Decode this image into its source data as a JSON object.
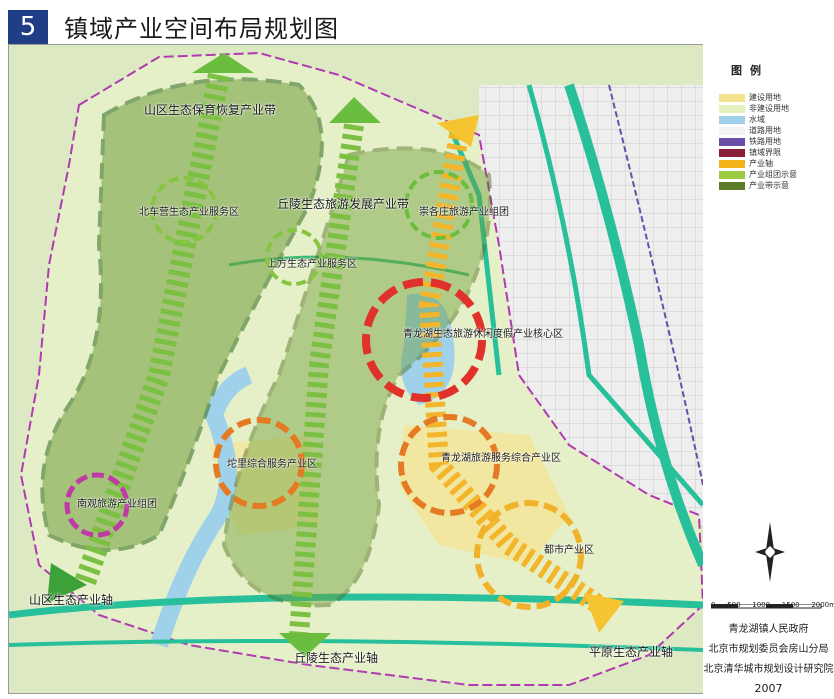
{
  "header": {
    "number": "5",
    "title": "镇域产业空间布局规划图"
  },
  "legend": {
    "title": "图例",
    "items": [
      {
        "label": "建设用地",
        "color": "#f6e38e"
      },
      {
        "label": "非建设用地",
        "color": "#e4f2bf"
      },
      {
        "label": "水域",
        "color": "#9fd2ea"
      },
      {
        "label": "道路用地",
        "color": "#f3f3f3"
      },
      {
        "label": "铁路用地",
        "color": "#6a4ea8"
      },
      {
        "label": "镇域界限",
        "color": "#8b1f3a"
      },
      {
        "label": "产业轴",
        "color": "#f2b31b"
      },
      {
        "label": "产业组团示意",
        "color": "#9ccc44"
      },
      {
        "label": "产业带示意",
        "color": "#5b7d2b"
      }
    ]
  },
  "map_labels": {
    "mountain_belt": "山区生态保育恢复产业带",
    "beichegying": "北车营生态产业服务区",
    "hill_belt": "丘陵生态旅游发展产业带",
    "chonggezhuang": "崇各庄旅游产业组团",
    "shangfang": "上方生态产业服务区",
    "qinglong_core": "青龙湖生态旅游休闲度假产业核心区",
    "tuoli": "坨里综合服务产业区",
    "qinglong_service": "青龙湖旅游服务综合产业区",
    "nanguan": "南观旅游产业组团",
    "dujia": "都市产业区",
    "axis_mountain": "山区生态产业轴",
    "axis_hill": "丘陵生态产业轴",
    "axis_plain": "平原生态产业轴"
  },
  "scale_bar": {
    "ticks": [
      "0",
      "500",
      "1000",
      "1500",
      "2000m"
    ]
  },
  "credits": [
    "青龙湖镇人民政府",
    "北京市规划委员会房山分局",
    "北京清华城市规划设计研究院",
    "2007"
  ]
}
